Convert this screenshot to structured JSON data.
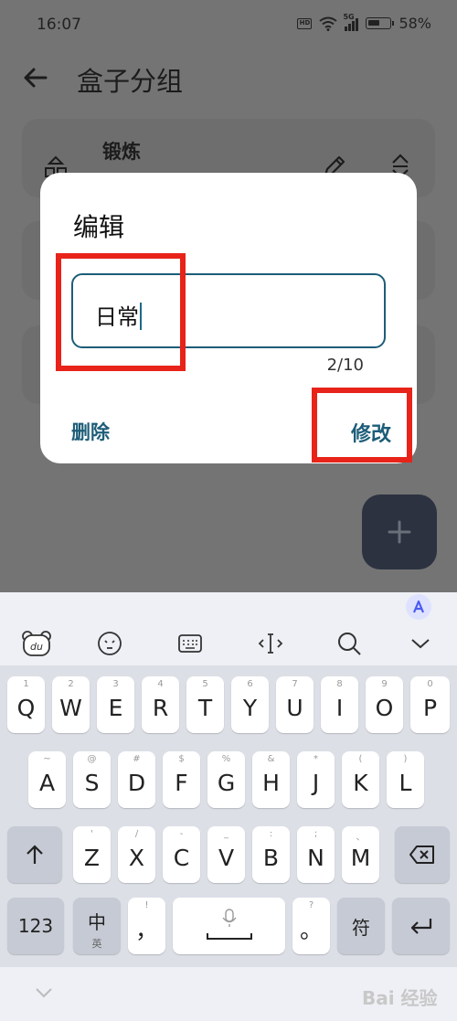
{
  "status_bar": {
    "time": "16:07",
    "hd": "HD",
    "network": "5G",
    "battery": "58%",
    "battery_level": 0.58
  },
  "header": {
    "back_icon": "arrow-left-icon",
    "title": "盒子分组"
  },
  "groups": [
    {
      "name": "锻炼"
    }
  ],
  "dialog": {
    "title": "编辑",
    "input_value": "日常",
    "char_count": "2/10",
    "delete_label": "删除",
    "modify_label": "修改"
  },
  "fab": {
    "icon": "plus-icon"
  },
  "keyboard": {
    "toolbar": [
      "du-bear-icon",
      "emoji-icon",
      "keyboard-icon",
      "cursor-icon",
      "search-icon",
      "chevron-down-icon"
    ],
    "row1": [
      {
        "main": "Q",
        "sub": "1"
      },
      {
        "main": "W",
        "sub": "2"
      },
      {
        "main": "E",
        "sub": "3"
      },
      {
        "main": "R",
        "sub": "4"
      },
      {
        "main": "T",
        "sub": "5"
      },
      {
        "main": "Y",
        "sub": "6"
      },
      {
        "main": "U",
        "sub": "7"
      },
      {
        "main": "I",
        "sub": "8"
      },
      {
        "main": "O",
        "sub": "9"
      },
      {
        "main": "P",
        "sub": "0"
      }
    ],
    "row2": [
      {
        "main": "A",
        "sub": "~"
      },
      {
        "main": "S",
        "sub": "@"
      },
      {
        "main": "D",
        "sub": "#"
      },
      {
        "main": "F",
        "sub": "$"
      },
      {
        "main": "G",
        "sub": "%"
      },
      {
        "main": "H",
        "sub": "&"
      },
      {
        "main": "J",
        "sub": "*"
      },
      {
        "main": "K",
        "sub": "("
      },
      {
        "main": "L",
        "sub": ")"
      }
    ],
    "row3": [
      {
        "main": "Z",
        "sub": "'"
      },
      {
        "main": "X",
        "sub": "/"
      },
      {
        "main": "C",
        "sub": "-"
      },
      {
        "main": "V",
        "sub": "_"
      },
      {
        "main": "B",
        "sub": ":"
      },
      {
        "main": "N",
        "sub": ";"
      },
      {
        "main": "M",
        "sub": "、"
      }
    ],
    "row4": {
      "num_label": "123",
      "lang_main": "中",
      "lang_sub": "英",
      "comma": "，",
      "comma_sub": "!",
      "period": "。",
      "period_sub": "?",
      "symbol_label": "符"
    }
  },
  "watermark": "Bai 经验"
}
